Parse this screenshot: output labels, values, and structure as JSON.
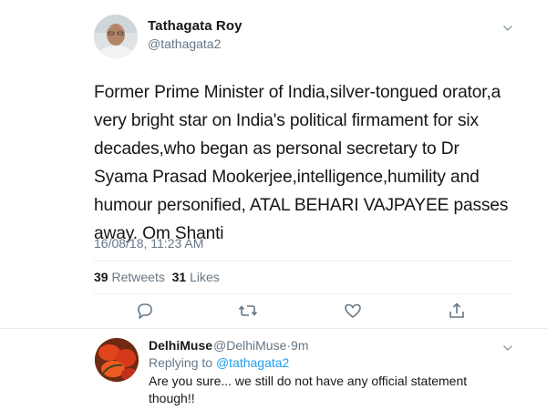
{
  "tweet": {
    "author_name": "Tathagata Roy",
    "author_handle": "@tathagata2",
    "text": "Former Prime Minister of India,silver-tongued orator,a very bright star on India's political firmament for six decades,who began as personal secretary to Dr Syama Prasad Mookerjee,intelligence,humility and humour personified, ATAL BEHARI VAJPAYEE passes away. Om Shanti",
    "timestamp": "16/08/18, 11:23 AM",
    "retweets_count": "39",
    "retweets_label": "Retweets",
    "likes_count": "31",
    "likes_label": "Likes"
  },
  "actions": [
    {
      "icon": "reply-icon"
    },
    {
      "icon": "retweet-icon"
    },
    {
      "icon": "like-icon"
    },
    {
      "icon": "share-icon"
    }
  ],
  "reply": {
    "author_name": "DelhiMuse",
    "author_handle": "@DelhiMuse",
    "separator": "·",
    "time": "9m",
    "replying_prefix": "Replying to",
    "replying_handle": "@tathagata2",
    "text": "Are you sure... we still do not have any official statement though!!"
  },
  "colors": {
    "accent": "#1da1f2",
    "muted": "#657786",
    "text": "#14171a",
    "divider": "#e6ecf0"
  }
}
